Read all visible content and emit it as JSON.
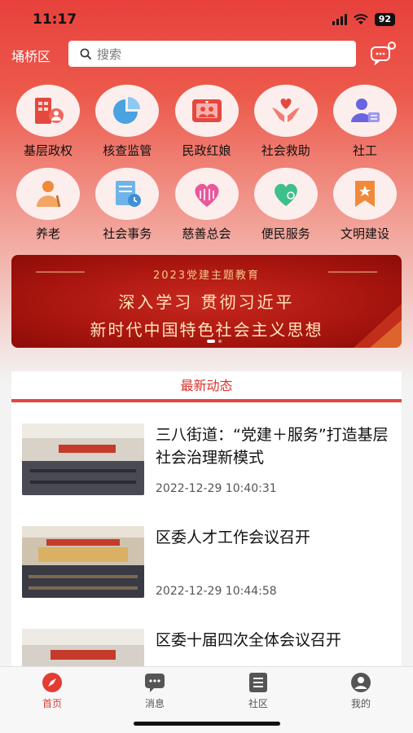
{
  "status": {
    "time": "11:17",
    "battery": "92"
  },
  "header": {
    "district": "埇桥区",
    "search_placeholder": "搜索"
  },
  "grid": [
    {
      "label": "基层政权",
      "icon": "building-person-icon"
    },
    {
      "label": "核查监管",
      "icon": "pie-chart-icon"
    },
    {
      "label": "民政红娘",
      "icon": "couple-heart-icon"
    },
    {
      "label": "社会救助",
      "icon": "hands-heart-icon"
    },
    {
      "label": "社工",
      "icon": "person-badge-icon"
    },
    {
      "label": "养老",
      "icon": "elderly-person-icon"
    },
    {
      "label": "社会事务",
      "icon": "document-clock-icon"
    },
    {
      "label": "慈善总会",
      "icon": "charity-heart-icon"
    },
    {
      "label": "便民服务",
      "icon": "service-heart-icon"
    },
    {
      "label": "文明建设",
      "icon": "star-ribbon-icon"
    }
  ],
  "banner": {
    "top": "2023党建主题教育",
    "line1": "深入学习 贯彻习近平",
    "line2": "新时代中国特色社会主义思想"
  },
  "news": {
    "title": "最新动态",
    "items": [
      {
        "headline": "三八街道：“党建＋服务”打造基层社会治理新模式",
        "time": "2022-12-29 10:40:31"
      },
      {
        "headline": "区委人才工作会议召开",
        "time": "2022-12-29 10:44:58"
      },
      {
        "headline": "区委十届四次全体会议召开",
        "time": ""
      }
    ]
  },
  "tabs": [
    {
      "label": "首页",
      "icon": "compass-icon",
      "active": true
    },
    {
      "label": "消息",
      "icon": "chat-bubble-icon",
      "active": false
    },
    {
      "label": "社区",
      "icon": "list-doc-icon",
      "active": false
    },
    {
      "label": "我的",
      "icon": "user-icon",
      "active": false
    }
  ],
  "colors": {
    "accent": "#e23c33",
    "banner": "#a8150f"
  }
}
